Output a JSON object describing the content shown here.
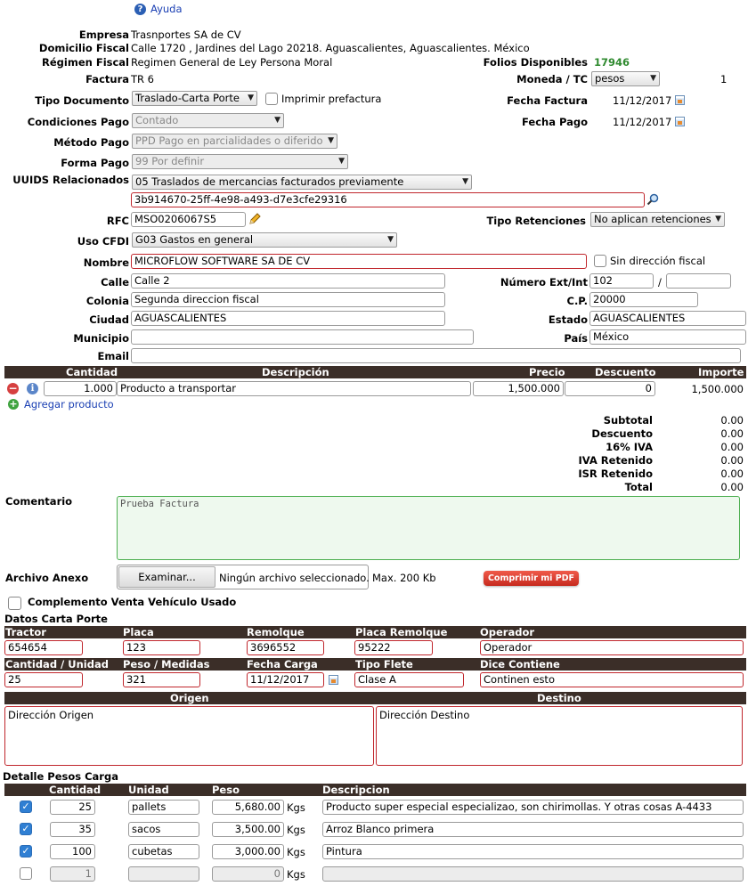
{
  "help": {
    "label": "Ayuda"
  },
  "company": {
    "empresa_label": "Empresa",
    "empresa": "Trasnportes SA de CV",
    "domicilio_label": "Domicilio Fiscal",
    "domicilio": "Calle 1720 , Jardines del Lago 20218. Aguascalientes, Aguascalientes. México",
    "regimen_label": "Régimen Fiscal",
    "regimen": "Regimen General de Ley Persona Moral",
    "folios_label": "Folios Disponibles",
    "folios": "17946"
  },
  "invoice": {
    "factura_label": "Factura",
    "factura": "TR 6",
    "moneda_label": "Moneda / TC",
    "moneda": "pesos",
    "tc": "1",
    "tipo_doc_label": "Tipo Documento",
    "tipo_doc": "Traslado-Carta Porte",
    "imprimir_label": "Imprimir prefactura",
    "fecha_factura_label": "Fecha Factura",
    "fecha_factura": "11/12/2017",
    "condiciones_label": "Condiciones Pago",
    "condiciones": "Contado",
    "fecha_pago_label": "Fecha Pago",
    "fecha_pago": "11/12/2017",
    "metodo_label": "Método Pago",
    "metodo": "PPD Pago en parcialidades o diferido",
    "forma_label": "Forma Pago",
    "forma": "99 Por definir",
    "uuids_label": "UUIDS Relacionados",
    "uuids_tipo": "05 Traslados de mercancias facturados previamente",
    "uuid": "3b914670-25ff-4e98-a493-d7e3cfe29316"
  },
  "client": {
    "rfc_label": "RFC",
    "rfc": "MSO0206067S5",
    "retenciones_label": "Tipo Retenciones",
    "retenciones": "No aplican retenciones",
    "uso_label": "Uso CFDI",
    "uso": "G03 Gastos en general",
    "nombre_label": "Nombre",
    "nombre": "MICROFLOW SOFTWARE SA DE CV",
    "sin_dir_label": "Sin dirección fiscal",
    "calle_label": "Calle",
    "calle": "Calle 2",
    "numero_label": "Número Ext/Int",
    "num_ext": "102",
    "num_sep": "/",
    "num_int": "",
    "colonia_label": "Colonia",
    "colonia": "Segunda direccion fiscal",
    "cp_label": "C.P.",
    "cp": "20000",
    "ciudad_label": "Ciudad",
    "ciudad": "AGUASCALIENTES",
    "estado_label": "Estado",
    "estado": "AGUASCALIENTES",
    "municipio_label": "Municipio",
    "municipio": "",
    "pais_label": "País",
    "pais": "México",
    "email_label": "Email",
    "email": ""
  },
  "products": {
    "headers": {
      "cantidad": "Cantidad",
      "descripcion": "Descripción",
      "precio": "Precio",
      "descuento": "Descuento",
      "importe": "Importe"
    },
    "rows": [
      {
        "cantidad": "1.000",
        "descripcion": "Producto a transportar",
        "precio": "1,500.000",
        "descuento": "0",
        "importe": "1,500.000"
      }
    ],
    "add_label": "Agregar producto"
  },
  "totals": {
    "subtotal_label": "Subtotal",
    "subtotal": "0.00",
    "descuento_label": "Descuento",
    "descuento": "0.00",
    "iva_label": "16% IVA",
    "iva": "0.00",
    "iva_ret_label": "IVA Retenido",
    "iva_ret": "0.00",
    "isr_ret_label": "ISR Retenido",
    "isr_ret": "0.00",
    "total_label": "Total",
    "total": "0.00"
  },
  "comment": {
    "label": "Comentario",
    "value": "Prueba Factura"
  },
  "attachment": {
    "label": "Archivo Anexo",
    "button": "Examinar...",
    "status": "Ningún archivo seleccionado.",
    "max": "Max. 200 Kb",
    "compress": "Comprimir mi PDF"
  },
  "vehicle": {
    "label": "Complemento Venta Vehículo Usado"
  },
  "carta": {
    "title": "Datos Carta Porte",
    "h1": [
      "Tractor",
      "Placa",
      "Remolque",
      "Placa Remolque",
      "Operador"
    ],
    "v1": [
      "654654",
      "123",
      "3696552",
      "95222",
      "Operador"
    ],
    "h2": [
      "Cantidad / Unidad",
      "Peso / Medidas",
      "Fecha Carga",
      "Tipo Flete",
      "Dice Contiene"
    ],
    "v2": [
      "25",
      "321",
      "11/12/2017",
      "Clase A",
      "Continen esto"
    ],
    "origen_label": "Origen",
    "destino_label": "Destino",
    "origen": "Dirección Origen",
    "destino": "Dirección Destino"
  },
  "pesos": {
    "title": "Detalle Pesos Carga",
    "headers": [
      "Cantidad",
      "Unidad",
      "Peso",
      "Descripcion"
    ],
    "unit": "Kgs",
    "rows": [
      {
        "checked": true,
        "cantidad": "25",
        "unidad": "pallets",
        "peso": "5,680.00",
        "descripcion": "Producto super especial especializao, son chirimollas. Y otras cosas A-4433"
      },
      {
        "checked": true,
        "cantidad": "35",
        "unidad": "sacos",
        "peso": "3,500.00",
        "descripcion": "Arroz Blanco primera"
      },
      {
        "checked": true,
        "cantidad": "100",
        "unidad": "cubetas",
        "peso": "3,000.00",
        "descripcion": "Pintura"
      },
      {
        "checked": false,
        "cantidad": "1",
        "unidad": "",
        "peso": "0",
        "descripcion": ""
      }
    ]
  }
}
